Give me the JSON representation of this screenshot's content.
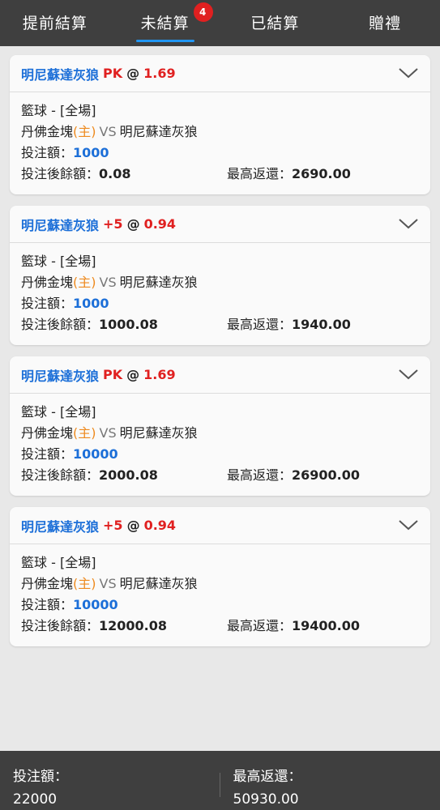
{
  "tabs": [
    {
      "label": "提前結算"
    },
    {
      "label": "未結算",
      "badge": "4"
    },
    {
      "label": "已結算"
    },
    {
      "label": "贈禮"
    }
  ],
  "colors": {
    "team": "#1c6fd8",
    "handicap": "#e02020",
    "home": "#ee8a1e",
    "tab_underline": "#2196f3"
  },
  "labels": {
    "sport": "籃球 - [全場]",
    "home_tag": "(主)",
    "vs": "VS",
    "stake": "投注額：",
    "balance": "投注後餘額：",
    "max_return": "最高返還：",
    "at": "@"
  },
  "bets": [
    {
      "pick": "明尼蘇達灰狼",
      "handicap": "PK",
      "odds": "1.69",
      "home": "丹佛金塊",
      "away": "明尼蘇達灰狼",
      "stake": "1000",
      "balance": "0.08",
      "max_return": "2690.00"
    },
    {
      "pick": "明尼蘇達灰狼",
      "handicap": "+5",
      "odds": "0.94",
      "home": "丹佛金塊",
      "away": "明尼蘇達灰狼",
      "stake": "1000",
      "balance": "1000.08",
      "max_return": "1940.00"
    },
    {
      "pick": "明尼蘇達灰狼",
      "handicap": "PK",
      "odds": "1.69",
      "home": "丹佛金塊",
      "away": "明尼蘇達灰狼",
      "stake": "10000",
      "balance": "2000.08",
      "max_return": "26900.00"
    },
    {
      "pick": "明尼蘇達灰狼",
      "handicap": "+5",
      "odds": "0.94",
      "home": "丹佛金塊",
      "away": "明尼蘇達灰狼",
      "stake": "10000",
      "balance": "12000.08",
      "max_return": "19400.00"
    }
  ],
  "footer": {
    "stake_label": "投注額：",
    "stake_total": "22000",
    "return_label": "最高返還：",
    "return_total": "50930.00"
  }
}
